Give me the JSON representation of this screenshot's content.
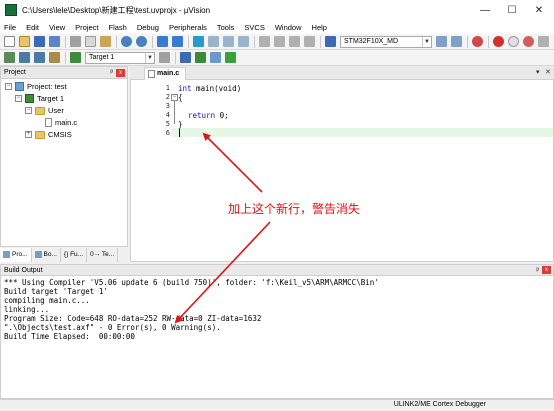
{
  "window": {
    "title": "C:\\Users\\lele\\Desktop\\新建工程\\test.uvprojx - µVision",
    "minimize": "—",
    "maximize": "☐",
    "close": "✕"
  },
  "menu": [
    "File",
    "Edit",
    "View",
    "Project",
    "Flash",
    "Debug",
    "Peripherals",
    "Tools",
    "SVCS",
    "Window",
    "Help"
  ],
  "toolbar": {
    "device_combo": "STM32F10X_MD",
    "target_combo": "Target 1"
  },
  "project_panel": {
    "title": "Project",
    "pin": "ᵖ",
    "close": "x",
    "tree": {
      "root": "Project: test",
      "target": "Target 1",
      "group_user": "User",
      "file_main": "main.c",
      "group_cmsis": "CMSIS"
    },
    "tabs": [
      "Pro...",
      "Bo...",
      "{} Fu...",
      "0→ Te..."
    ]
  },
  "editor": {
    "tab": "main.c",
    "line_numbers": [
      "1",
      "2",
      "3",
      "4",
      "5",
      "6"
    ],
    "code": {
      "line1_kw": "int",
      "line1_rest": " main(void)",
      "line2": "{",
      "line4_kw": "return",
      "line4_rest": " 0;",
      "line5": "}"
    }
  },
  "build_output": {
    "title": "Build Output",
    "lines": [
      "*** Using Compiler 'V5.06 update 6 (build 750)', folder: 'f:\\Keil_v5\\ARM\\ARMCC\\Bin'",
      "Build target 'Target 1'",
      "compiling main.c...",
      "linking...",
      "Program Size: Code=648 RO-data=252 RW-data=0 ZI-data=1632",
      "\".\\Objects\\test.axf\" - 0 Error(s), 0 Warning(s).",
      "Build Time Elapsed:  00:00:00"
    ]
  },
  "status_bar": {
    "debugger": "ULINK2/ME Cortex Debugger"
  },
  "annotation": {
    "text": "加上这个新行，警告消失",
    "color": "#e0141a"
  }
}
